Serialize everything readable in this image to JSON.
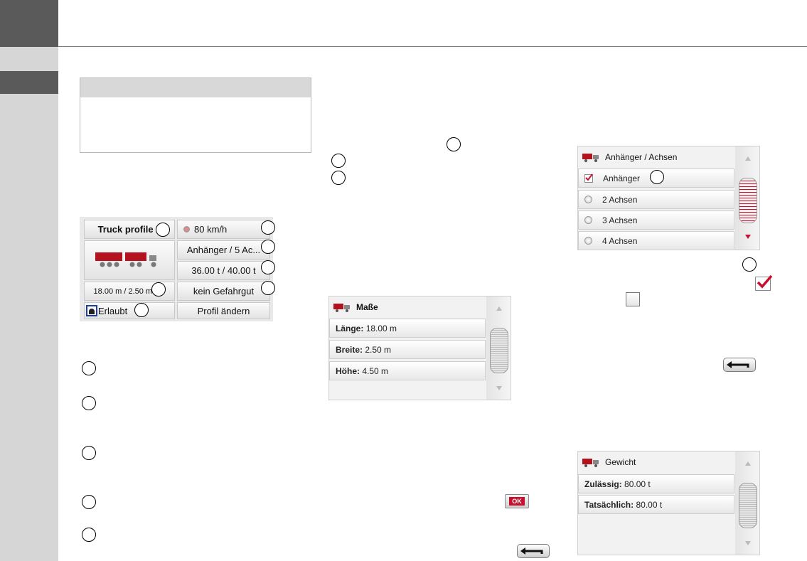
{
  "profile_panel": {
    "profile_name": "Truck profile 1",
    "speed": "80 km/h",
    "trailer_axles": "Anhänger / 5 Ac...",
    "weight": "36.00 t / 40.00 t",
    "dimensions": "18.00 m / 2.50 m / ...",
    "hazmat": "kein Gefahrgut",
    "tunnel": "Erlaubt",
    "change_profile": "Profil ändern"
  },
  "screen_masse": {
    "title": "Maße",
    "rows": [
      {
        "label": "Länge:",
        "value": "18.00 m"
      },
      {
        "label": "Breite:",
        "value": "2.50 m"
      },
      {
        "label": "Höhe:",
        "value": "4.50 m"
      }
    ]
  },
  "screen_achsen": {
    "title": "Anhänger / Achsen",
    "rows": [
      {
        "label": "Anhänger",
        "checked": true
      },
      {
        "label": "2 Achsen"
      },
      {
        "label": "3 Achsen"
      },
      {
        "label": "4 Achsen"
      }
    ]
  },
  "screen_gewicht": {
    "title": "Gewicht",
    "rows": [
      {
        "label": "Zulässig:",
        "value": "80.00 t"
      },
      {
        "label": "Tatsächlich:",
        "value": "80.00 t"
      }
    ]
  },
  "ok_button": "OK",
  "colors": {
    "sidebar_dark": "#5a5a5a",
    "sidebar_light": "#d6d6d6",
    "accent_red": "#c8102e",
    "tunnel_icon_border": "#1a3fa0"
  },
  "icons": [
    "truck-icon",
    "speed-dot-icon",
    "tunnel-icon",
    "checkbox-checked-icon",
    "checkbox-empty-icon",
    "back-arrow-icon",
    "radio-icon",
    "scroll-up-icon",
    "scroll-down-icon"
  ]
}
